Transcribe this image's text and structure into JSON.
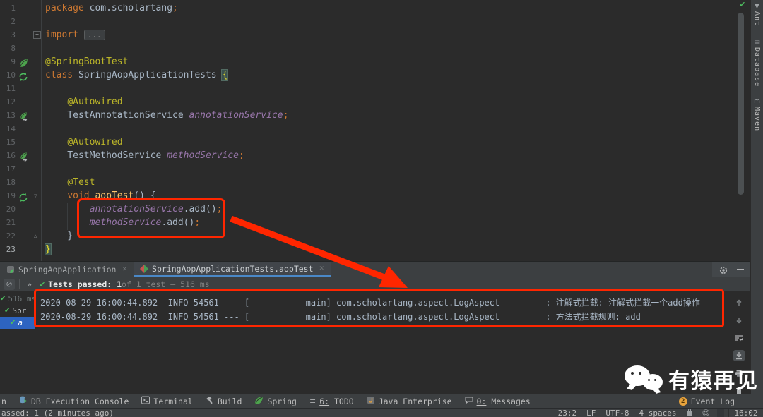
{
  "window": {
    "bg": "#2b2b2b",
    "accent_blue": "#4A88C7",
    "annotation_red": "#FF2600"
  },
  "editor": {
    "inspection_check": "✔",
    "lines": [
      {
        "num": "1",
        "tokens": [
          {
            "t": "package ",
            "c": "kw"
          },
          {
            "t": "com.scholartang",
            "c": "pl"
          },
          {
            "t": ";",
            "c": "kw"
          }
        ]
      },
      {
        "num": "2",
        "tokens": []
      },
      {
        "num": "3",
        "fold": "box",
        "tokens": [
          {
            "t": "import ",
            "c": "kw"
          },
          {
            "t": "...",
            "c": "fold"
          }
        ]
      },
      {
        "num": "8",
        "tokens": []
      },
      {
        "num": "9",
        "icon": "spring-leaf",
        "tokens": [
          {
            "t": "@SpringBootTest",
            "c": "an"
          }
        ]
      },
      {
        "num": "10",
        "icon": "run-test",
        "tokens": [
          {
            "t": "class ",
            "c": "kw"
          },
          {
            "t": "SpringAopApplicationTests ",
            "c": "pl"
          },
          {
            "t": "{",
            "c": "bh"
          }
        ]
      },
      {
        "num": "11",
        "tokens": []
      },
      {
        "num": "12",
        "tokens": [
          {
            "t": "    ",
            "c": "pl"
          },
          {
            "t": "@Autowired",
            "c": "an"
          }
        ]
      },
      {
        "num": "13",
        "icon": "spring-bean",
        "tokens": [
          {
            "t": "    TestAnnotationService ",
            "c": "pl"
          },
          {
            "t": "annotationService",
            "c": "fd"
          },
          {
            "t": ";",
            "c": "kw"
          }
        ]
      },
      {
        "num": "14",
        "tokens": []
      },
      {
        "num": "15",
        "tokens": [
          {
            "t": "    ",
            "c": "pl"
          },
          {
            "t": "@Autowired",
            "c": "an"
          }
        ]
      },
      {
        "num": "16",
        "icon": "spring-bean",
        "tokens": [
          {
            "t": "    TestMethodService ",
            "c": "pl"
          },
          {
            "t": "methodService",
            "c": "fd"
          },
          {
            "t": ";",
            "c": "kw"
          }
        ]
      },
      {
        "num": "17",
        "tokens": []
      },
      {
        "num": "18",
        "tokens": [
          {
            "t": "    ",
            "c": "pl"
          },
          {
            "t": "@Test",
            "c": "an"
          }
        ]
      },
      {
        "num": "19",
        "icon": "run-test",
        "fold": "down",
        "tokens": [
          {
            "t": "    ",
            "c": "pl"
          },
          {
            "t": "void ",
            "c": "kw"
          },
          {
            "t": "aopTest",
            "c": "mt"
          },
          {
            "t": "() {",
            "c": "pl"
          }
        ]
      },
      {
        "num": "20",
        "tokens": [
          {
            "t": "        ",
            "c": "pl"
          },
          {
            "t": "annotationService",
            "c": "fd"
          },
          {
            "t": ".add()",
            "c": "pl"
          },
          {
            "t": ";",
            "c": "kw"
          }
        ]
      },
      {
        "num": "21",
        "tokens": [
          {
            "t": "        ",
            "c": "pl"
          },
          {
            "t": "methodService",
            "c": "fd"
          },
          {
            "t": ".add()",
            "c": "pl"
          },
          {
            "t": ";",
            "c": "kw"
          }
        ]
      },
      {
        "num": "22",
        "fold": "up",
        "tokens": [
          {
            "t": "    }",
            "c": "pl"
          }
        ]
      },
      {
        "num": "23",
        "current": true,
        "tokens": [
          {
            "t": "}",
            "c": "bh"
          }
        ]
      }
    ]
  },
  "right_bar": {
    "items": [
      {
        "name": "ant",
        "glyph": "▼",
        "label": "Ant"
      },
      {
        "name": "database",
        "glyph": "▤",
        "label": "Database"
      },
      {
        "name": "maven",
        "glyph": "m",
        "label": "Maven"
      }
    ]
  },
  "run_panel": {
    "tabs": [
      {
        "name": "spring-aop-application",
        "icon": "spring-run",
        "label": "SpringAopApplication",
        "close": "✕",
        "active": false
      },
      {
        "name": "spring-aop-application-tests-aoptest",
        "icon": "junit-test",
        "label": "SpringAopApplicationTests.aopTest",
        "close": "✕",
        "active": true
      }
    ],
    "toolbar": {
      "stop": "⊘",
      "chevrons": "»",
      "check": "✔",
      "status_strong": "Tests passed: 1",
      "status_rest": " of 1 test – 516 ms"
    },
    "tree": [
      {
        "check": "✔",
        "label": "516 ms",
        "style": "muted",
        "indent": 0,
        "selected": false
      },
      {
        "check": "✔",
        "label": "Spr",
        "style": "normal",
        "indent": 6,
        "selected": false
      },
      {
        "check": "✔",
        "label": "a",
        "style": "italic",
        "indent": 14,
        "selected": true
      }
    ],
    "console_lines": [
      "2020-08-29 16:00:44.892  INFO 54561 --- [           main] com.scholartang.aspect.LogAspect         : 注解式拦截: 注解式拦截一个add操作",
      "2020-08-29 16:00:44.892  INFO 54561 --- [           main] com.scholartang.aspect.LogAspect         : 方法式拦截规则: add"
    ],
    "console_icons": [
      {
        "name": "navigate-up",
        "svg": "arrow-up",
        "selected": false
      },
      {
        "name": "navigate-down",
        "svg": "arrow-down",
        "selected": false
      },
      {
        "name": "soft-wrap",
        "svg": "soft-wrap",
        "selected": false
      },
      {
        "name": "scroll-to-end",
        "svg": "scroll-end",
        "selected": true
      },
      {
        "name": "print",
        "svg": "printer",
        "selected": false
      },
      {
        "name": "clear-console",
        "svg": "trash",
        "selected": false
      }
    ]
  },
  "bottom_bar": {
    "items": [
      {
        "name": "run",
        "label": "n"
      },
      {
        "name": "db-execution-console",
        "svg": "db-console",
        "label": "DB Execution Console"
      },
      {
        "name": "terminal",
        "svg": "terminal",
        "label": "Terminal"
      },
      {
        "name": "build",
        "svg": "hammer",
        "label": "Build"
      },
      {
        "name": "spring",
        "svg": "spring-leaf",
        "label": "Spring"
      },
      {
        "name": "todo",
        "glyph": "≡",
        "label": "6: TODO",
        "mnemonic": true
      },
      {
        "name": "java-enterprise",
        "svg": "jee",
        "label": "Java Enterprise"
      },
      {
        "name": "messages",
        "svg": "messages",
        "label": "0: Messages",
        "mnemonic": true
      }
    ],
    "event_log": {
      "badge": "2",
      "label": "Event Log"
    }
  },
  "status_bar": {
    "left": "assed: 1 (2 minutes ago)",
    "widgets": [
      "23:2",
      "LF",
      "UTF-8",
      "4 spaces"
    ],
    "hector": "☺",
    "clock": "16:02"
  },
  "watermark": {
    "text": "有猿再见"
  }
}
